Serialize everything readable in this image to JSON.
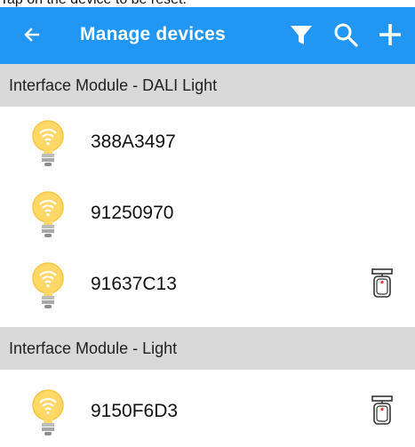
{
  "instruction": "Tap on the device to be reset.",
  "appbar": {
    "title": "Manage devices",
    "color": "#2196f3",
    "icons": [
      "back-arrow-icon",
      "filter-icon",
      "search-icon",
      "add-icon"
    ]
  },
  "sections": [
    {
      "header": "Interface Module - DALI Light",
      "devices": [
        {
          "name": "388A3497",
          "icon": "light-bulb-icon",
          "remote": false
        },
        {
          "name": "91250970",
          "icon": "light-bulb-icon",
          "remote": false
        },
        {
          "name": "91637C13",
          "icon": "light-bulb-icon",
          "remote": true
        }
      ]
    },
    {
      "header": "Interface Module - Light",
      "devices": [
        {
          "name": "9150F6D3",
          "icon": "light-bulb-icon",
          "remote": true
        }
      ]
    }
  ]
}
